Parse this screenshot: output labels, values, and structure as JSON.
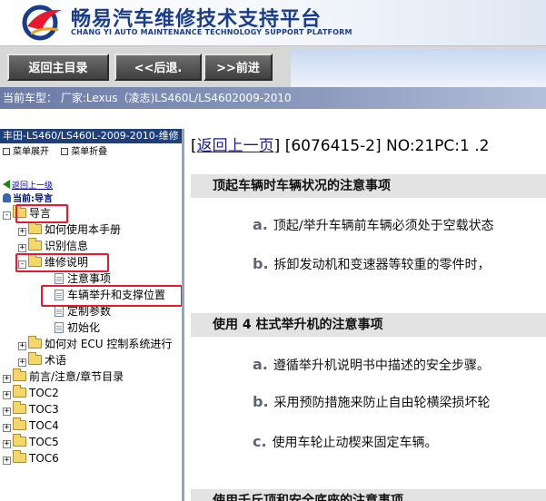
{
  "header": {
    "title": "畅易汽车维修技术支持平台",
    "subtitle": "CHANG YI AUTO MAINTENANCE TECHNOLOGY SUPPORT PLATFORM",
    "logo_icon": "changyi-logo-icon"
  },
  "toolbar": {
    "home_label": "返回主目录",
    "back_label": "<<后退.",
    "forward_label": ">>前进"
  },
  "model_bar": {
    "text": "当前车型： 厂家:Lexus（凌志)LS460L/LS4602009-2010"
  },
  "left_pane": {
    "title": "丰田-LS460/LS460L-2009-2010-维修",
    "expand_label": "菜单展开",
    "collapse_label": "菜单折叠",
    "back_up_label": "返回上一级",
    "current_label": "当前:导言",
    "tree": [
      {
        "label": "导言",
        "type": "folder",
        "state": "-",
        "highlighted": true
      },
      {
        "label": "如何使用本手册",
        "type": "folder",
        "state": "+"
      },
      {
        "label": "识别信息",
        "type": "folder",
        "state": "+"
      },
      {
        "label": "维修说明",
        "type": "folder",
        "state": "-",
        "highlighted": true
      },
      {
        "label": "注意事项",
        "type": "doc"
      },
      {
        "label": "车辆举升和支撑位置",
        "type": "doc",
        "highlighted": true
      },
      {
        "label": "定制参数",
        "type": "doc"
      },
      {
        "label": "初始化",
        "type": "doc"
      },
      {
        "label": "如何对 ECU 控制系统进行",
        "type": "folder",
        "state": "+"
      },
      {
        "label": "术语",
        "type": "folder",
        "state": "+"
      },
      {
        "label": "前言/注意/章节目录",
        "type": "folder",
        "state": "+"
      },
      {
        "label": "TOC2",
        "type": "folder",
        "state": "+"
      },
      {
        "label": "TOC3",
        "type": "folder",
        "state": "+"
      },
      {
        "label": "TOC4",
        "type": "folder",
        "state": "+"
      },
      {
        "label": "TOC5",
        "type": "folder",
        "state": "+"
      },
      {
        "label": "TOC6",
        "type": "folder",
        "state": "+"
      }
    ]
  },
  "content": {
    "back_link": "返回上一页",
    "doc_id": "[6076415-2] NO:21PC:1 .2",
    "sections": [
      {
        "heading": "顶起车辆时车辆状况的注意事项",
        "items": [
          {
            "letter": "a.",
            "text": "顶起/举升车辆前车辆必须处于空载状态"
          },
          {
            "letter": "b.",
            "text": "拆卸发动机和变速器等较重的零件时，"
          }
        ]
      },
      {
        "heading": "使用 4 柱式举升机的注意事项",
        "items": [
          {
            "letter": "a.",
            "text": "遵循举升机说明书中描述的安全步骤。"
          },
          {
            "letter": "b.",
            "text": "采用预防措施来防止自由轮横梁损坏轮"
          },
          {
            "letter": "c.",
            "text": "使用车轮止动楔来固定车辆。"
          }
        ]
      },
      {
        "heading": "使用千斤顶和安全底座的注意事项",
        "items": []
      }
    ]
  },
  "colors": {
    "brand_blue": "#1a3c8f",
    "highlight_red": "#e8192c",
    "left_title_bg": "#1f3f7a",
    "section_bg": "#e3e3e3"
  }
}
